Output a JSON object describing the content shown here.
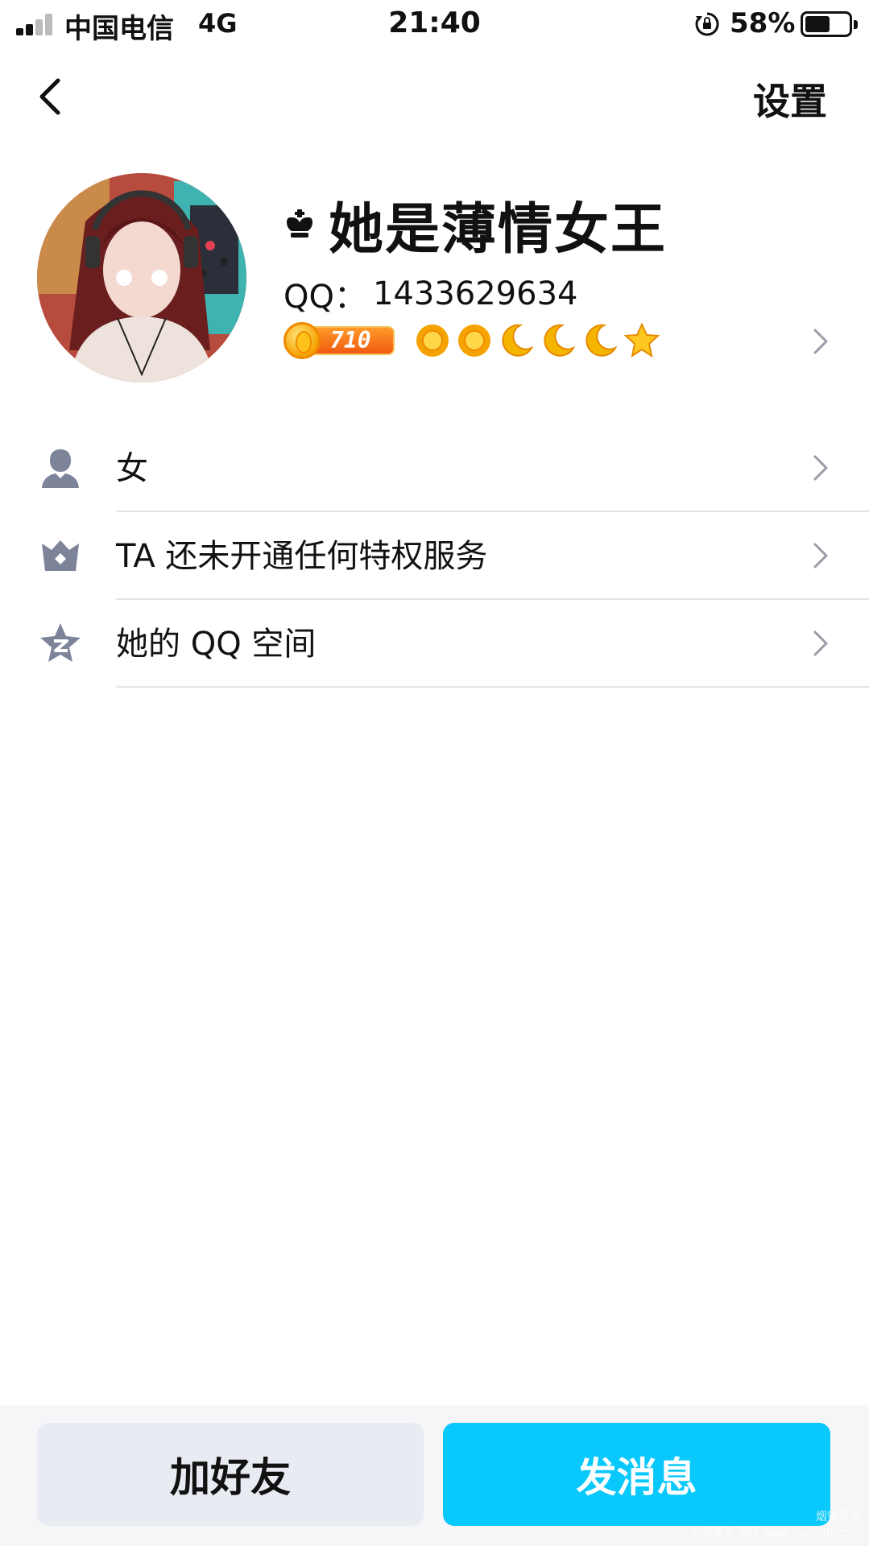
{
  "status_bar": {
    "carrier": "中国电信",
    "network": "4G",
    "time": "21:40",
    "battery_percent": "58%",
    "battery_level": 0.58,
    "signal_bars": 2
  },
  "nav": {
    "settings_label": "设置"
  },
  "profile": {
    "nickname": "她是薄情女王",
    "qq_label": "QQ：",
    "qq_number": "1433629634",
    "coin_count": "710",
    "level_icons": [
      "sun-icon",
      "sun-icon",
      "moon-icon",
      "moon-icon",
      "moon-icon",
      "star-icon"
    ]
  },
  "list": {
    "items": [
      {
        "icon": "person-icon",
        "label": "女"
      },
      {
        "icon": "crown-badge-icon",
        "label": "TA 还未开通任何特权服务"
      },
      {
        "icon": "qzone-star-icon",
        "label": "她的 QQ 空间"
      }
    ]
  },
  "actions": {
    "add_friend": "加好友",
    "send_message": "发消息"
  },
  "colors": {
    "accent": "#09c8fb",
    "secondary_button": "#e8ebf1",
    "icon_gray": "#7d849a"
  },
  "watermark": {
    "line1": "烟锁菁华",
    "line2": "©黑客生活网 www.hackdh.com"
  }
}
